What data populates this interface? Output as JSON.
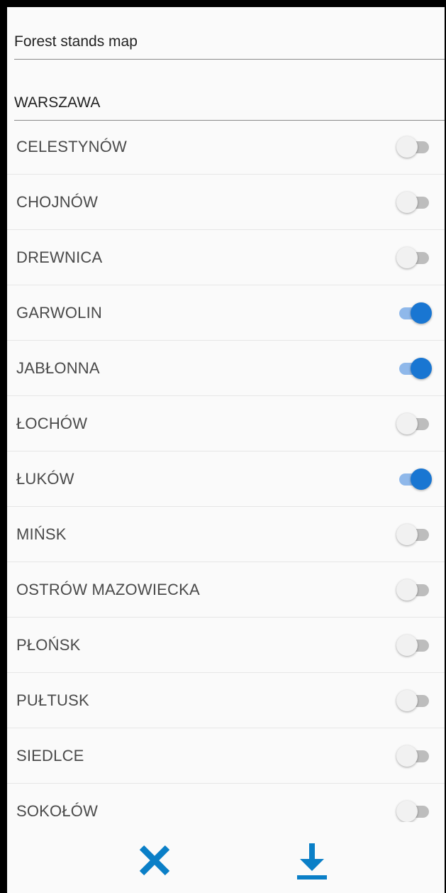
{
  "fields": {
    "map_type": "Forest stands map",
    "region": "WARSZAWA"
  },
  "districts": [
    {
      "label": "CELESTYNÓW",
      "enabled": false
    },
    {
      "label": "CHOJNÓW",
      "enabled": false
    },
    {
      "label": "DREWNICA",
      "enabled": false
    },
    {
      "label": "GARWOLIN",
      "enabled": true
    },
    {
      "label": "JABŁONNA",
      "enabled": true
    },
    {
      "label": "ŁOCHÓW",
      "enabled": false
    },
    {
      "label": "ŁUKÓW",
      "enabled": true
    },
    {
      "label": "MIŃSK",
      "enabled": false
    },
    {
      "label": "OSTRÓW MAZOWIECKA",
      "enabled": false
    },
    {
      "label": "PŁOŃSK",
      "enabled": false
    },
    {
      "label": "PUŁTUSK",
      "enabled": false
    },
    {
      "label": "SIEDLCE",
      "enabled": false
    },
    {
      "label": "SOKOŁÓW",
      "enabled": false
    }
  ],
  "actions": {
    "close_icon": "close-icon",
    "download_icon": "download-icon"
  },
  "colors": {
    "accent": "#1976d2",
    "action_blue": "#0a7fc7",
    "switch_on_track": "#8fb8ea",
    "switch_off_track": "#bdbdbd"
  }
}
